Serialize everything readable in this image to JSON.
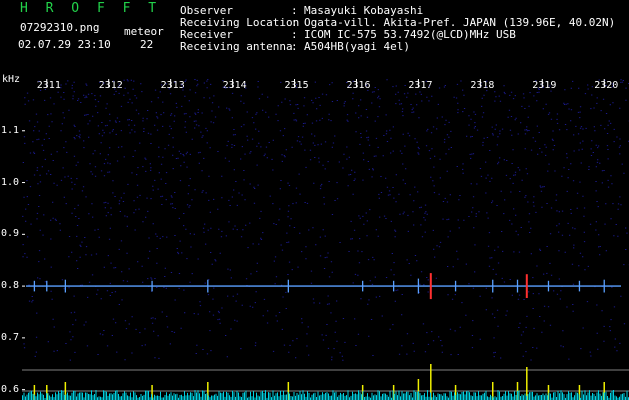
{
  "header": {
    "brand": "H R O F F T",
    "filename": "07292310.png",
    "timestamp": "02.07.29 23:10",
    "meteor_label": "meteor",
    "meteor_count": "22",
    "info": [
      {
        "key": "Observer",
        "value": "Masayuki Kobayashi"
      },
      {
        "key": "Receiving Location",
        "value": "Ogata-vill. Akita-Pref. JAPAN (139.96E, 40.02N)"
      },
      {
        "key": "Receiver",
        "value": "ICOM IC-575 53.7492(@LCD)MHz USB"
      },
      {
        "key": "Receiving antenna",
        "value": "A504HB(yagi 4el)"
      }
    ]
  },
  "colors": {
    "background": "#000000",
    "brand": "#22d24a",
    "noise": "#1a1a8c",
    "carrier": "#5aa0ff",
    "meteor": "#ff3030",
    "spectrum": "#00d0e0",
    "peaks": "#f0f000"
  },
  "chart_data": {
    "type": "heatmap",
    "ylabel": "kHz",
    "ylim": [
      0.58,
      1.2
    ],
    "yticks": [
      "1.1",
      "1.0",
      "0.9",
      "0.8",
      "0.7",
      "0.6"
    ],
    "x_ticks": [
      "2311",
      "2312",
      "2313",
      "2314",
      "2315",
      "2316",
      "2317",
      "2318",
      "2319",
      "2320"
    ],
    "xlim": [
      2310.6,
      2320.4
    ],
    "carrier_khz": 0.8,
    "meteor_echoes": [
      {
        "time": 2310.8,
        "strength": 0.3
      },
      {
        "time": 2311.0,
        "strength": 0.3
      },
      {
        "time": 2311.3,
        "strength": 0.4
      },
      {
        "time": 2312.7,
        "strength": 0.3
      },
      {
        "time": 2313.6,
        "strength": 0.4
      },
      {
        "time": 2314.9,
        "strength": 0.4
      },
      {
        "time": 2316.1,
        "strength": 0.3
      },
      {
        "time": 2316.6,
        "strength": 0.3
      },
      {
        "time": 2317.0,
        "strength": 0.5
      },
      {
        "time": 2317.2,
        "strength": 1.0
      },
      {
        "time": 2317.6,
        "strength": 0.3
      },
      {
        "time": 2318.2,
        "strength": 0.4
      },
      {
        "time": 2318.6,
        "strength": 0.4
      },
      {
        "time": 2318.75,
        "strength": 0.9
      },
      {
        "time": 2319.1,
        "strength": 0.3
      },
      {
        "time": 2319.6,
        "strength": 0.3
      },
      {
        "time": 2320.0,
        "strength": 0.4
      }
    ]
  }
}
